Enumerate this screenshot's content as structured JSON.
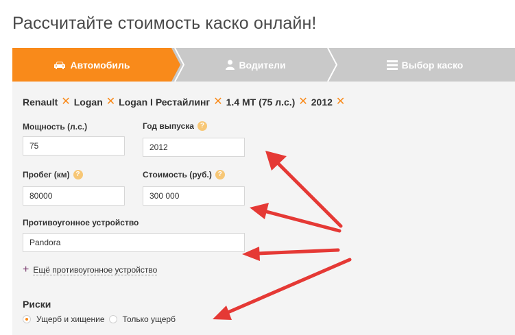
{
  "page": {
    "title": "Рассчитайте стоимость каско онлайн!"
  },
  "steps": [
    {
      "label": "Автомобиль",
      "icon": "car-icon",
      "active": true
    },
    {
      "label": "Водители",
      "icon": "person-icon",
      "active": false
    },
    {
      "label": "Выбор каско",
      "icon": "list-icon",
      "active": false
    }
  ],
  "car_summary": [
    "Renault",
    "Logan",
    "Logan I Рестайлинг",
    "1.4 MT (75 л.с.)",
    "2012"
  ],
  "fields": {
    "power": {
      "label": "Мощность (л.с.)",
      "value": "75"
    },
    "year": {
      "label": "Год выпуска",
      "value": "2012"
    },
    "mileage": {
      "label": "Пробег (км)",
      "value": "80000"
    },
    "cost": {
      "label": "Стоимость (руб.)",
      "value": "300 000"
    },
    "antitheft": {
      "label": "Противоугонное устройство",
      "value": "Pandora"
    }
  },
  "help_glyph": "?",
  "add_antitheft": {
    "plus": "+",
    "label": "Ещё противоугонное устройство"
  },
  "risks": {
    "title": "Риски",
    "options": [
      {
        "label": "Ущерб и хищение",
        "selected": true
      },
      {
        "label": "Только ущерб",
        "selected": false
      }
    ]
  },
  "colors": {
    "accent": "#f98a1a",
    "step_inactive": "#c9c9c9",
    "annotation_arrow": "#e53935"
  }
}
